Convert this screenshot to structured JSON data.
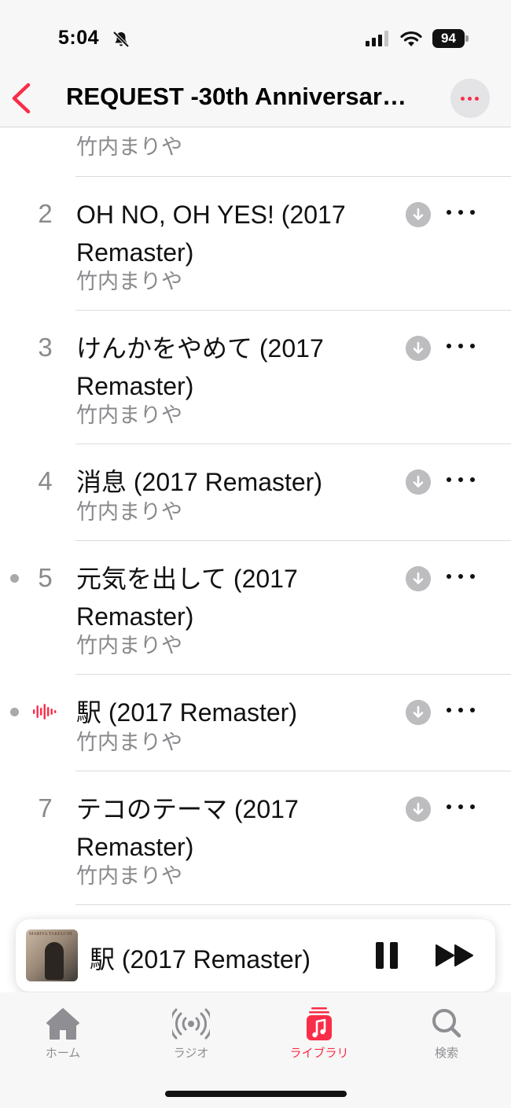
{
  "status_bar": {
    "time": "5:04",
    "battery": "94"
  },
  "header": {
    "title": "REQUEST -30th Anniversar…"
  },
  "tracks": [
    {
      "number": "",
      "title": "",
      "artist": "竹内まりや"
    },
    {
      "number": "2",
      "title": "OH NO, OH YES! (2017 Remaster)",
      "artist": "竹内まりや"
    },
    {
      "number": "3",
      "title": "けんかをやめて (2017 Remaster)",
      "artist": "竹内まりや"
    },
    {
      "number": "4",
      "title": "消息 (2017 Remaster)",
      "artist": "竹内まりや"
    },
    {
      "number": "5",
      "title": "元気を出して (2017 Remaster)",
      "artist": "竹内まりや"
    },
    {
      "number": "",
      "title": "駅 (2017 Remaster)",
      "artist": "竹内まりや"
    },
    {
      "number": "7",
      "title": "テコのテーマ (2017 Remaster)",
      "artist": "竹内まりや"
    }
  ],
  "now_playing": {
    "title": "駅 (2017 Remaster)",
    "album_art_text": "MARIYA TAKEUCHI"
  },
  "tabs": [
    {
      "label": "ホーム",
      "icon": "house-icon"
    },
    {
      "label": "ラジオ",
      "icon": "radio-icon"
    },
    {
      "label": "ライブラリ",
      "icon": "library-icon"
    },
    {
      "label": "検索",
      "icon": "search-icon"
    }
  ],
  "colors": {
    "accent": "#fa2d48",
    "secondary_text": "#8a8a8e"
  }
}
